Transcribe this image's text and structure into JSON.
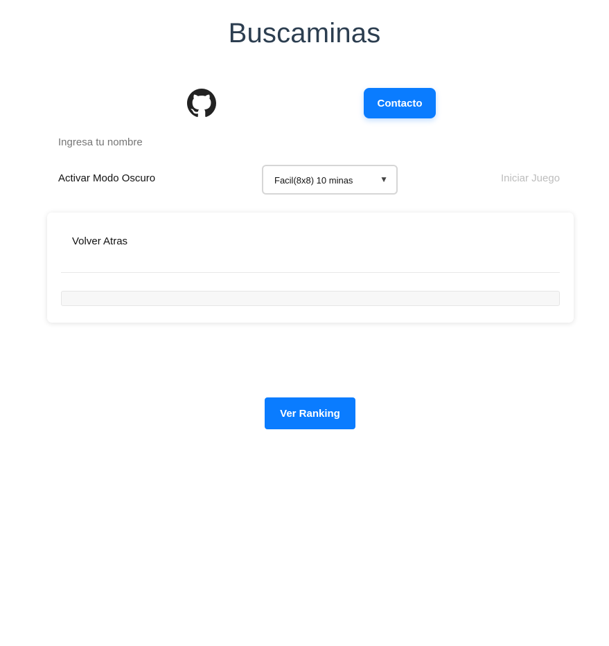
{
  "header": {
    "title": "Buscaminas"
  },
  "links": {
    "github_icon": "github-icon",
    "contact_label": "Contacto"
  },
  "form": {
    "name_label": "Ingresa tu nombre",
    "dark_mode_label": "Activar Modo Oscuro",
    "difficulty_selected": "Facil(8x8) 10 minas",
    "start_label": "Iniciar Juego"
  },
  "panel": {
    "back_label": "Volver Atras"
  },
  "footer": {
    "ranking_label": "Ver Ranking"
  },
  "colors": {
    "primary": "#0a7cff",
    "title": "#2c3e50",
    "muted": "#757575",
    "disabled": "#bdbdbd"
  }
}
